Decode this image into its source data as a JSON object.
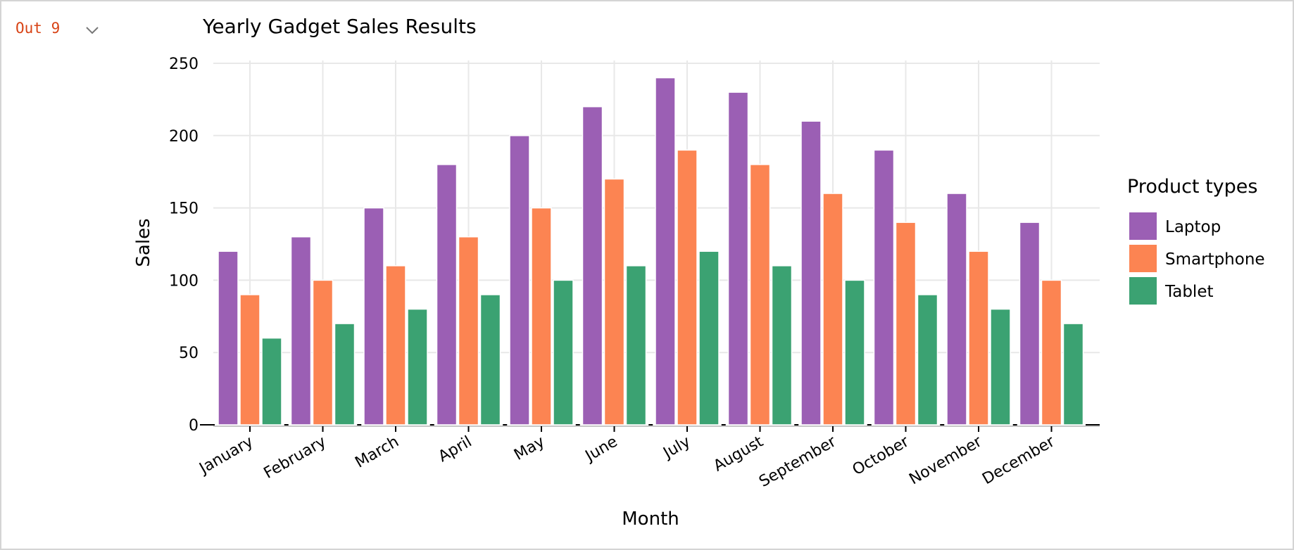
{
  "cell": {
    "output_label": "Out 9",
    "collapse_icon": "chevron-down-icon",
    "label_color": "#d84315"
  },
  "chart_data": {
    "type": "bar",
    "title": "Yearly Gadget Sales Results",
    "xlabel": "Month",
    "ylabel": "Sales",
    "ylim": [
      0,
      250
    ],
    "yticks": [
      0,
      50,
      100,
      150,
      200,
      250
    ],
    "grid": true,
    "legend": {
      "title": "Product types",
      "placement": "right"
    },
    "categories": [
      "January",
      "February",
      "March",
      "April",
      "May",
      "June",
      "July",
      "August",
      "September",
      "October",
      "November",
      "December"
    ],
    "series": [
      {
        "name": "Laptop",
        "color": "#9b5fb4",
        "values": [
          120,
          130,
          150,
          180,
          200,
          220,
          240,
          230,
          210,
          190,
          160,
          140
        ]
      },
      {
        "name": "Smartphone",
        "color": "#fc8452",
        "values": [
          90,
          100,
          110,
          130,
          150,
          170,
          190,
          180,
          160,
          140,
          120,
          100
        ]
      },
      {
        "name": "Tablet",
        "color": "#3ba272",
        "values": [
          60,
          70,
          80,
          90,
          100,
          110,
          120,
          110,
          100,
          90,
          80,
          70
        ]
      }
    ]
  }
}
